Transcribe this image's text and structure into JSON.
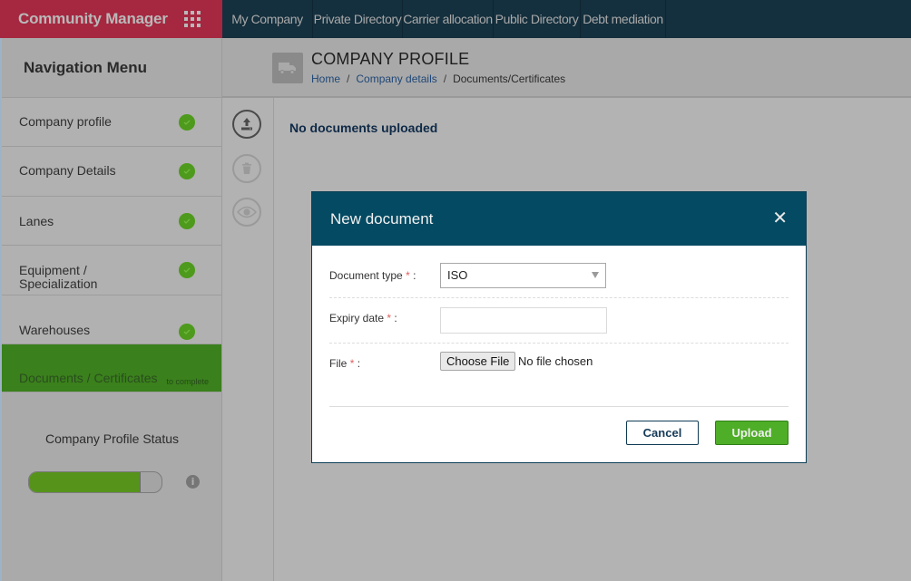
{
  "app": {
    "title": "Community Manager",
    "apps_icon": "grid-icon"
  },
  "topnav": {
    "items": [
      {
        "label": "My Company"
      },
      {
        "label": "Private Directory"
      },
      {
        "label": "Carrier allocation"
      },
      {
        "label": "Public Directory"
      },
      {
        "label": "Debt mediation"
      }
    ]
  },
  "sidebar": {
    "title": "Navigation Menu",
    "items": [
      {
        "label": "Company profile",
        "status": "complete",
        "icon": "check-icon"
      },
      {
        "label": "Company Details",
        "status": "complete",
        "icon": "check-icon"
      },
      {
        "label": "Lanes",
        "status": "complete",
        "icon": "check-icon"
      },
      {
        "label": "Equipment / Specialization",
        "status": "complete",
        "icon": "check-icon"
      },
      {
        "label": "Warehouses",
        "status": "complete",
        "icon": "check-icon"
      },
      {
        "label": "Documents / Certificates",
        "status": "to complete",
        "active": true
      }
    ],
    "todo_label": "to complete",
    "profile_status": {
      "title": "Company Profile Status",
      "progress_percent": 84,
      "info_icon": "info-icon"
    }
  },
  "page": {
    "icon": "truck-icon",
    "title": "COMPANY PROFILE",
    "breadcrumb": [
      {
        "label": "Home",
        "link": true
      },
      {
        "label": "Company details",
        "link": true
      },
      {
        "label": "Documents/Certificates",
        "link": false
      }
    ],
    "separator": "/"
  },
  "toolbar": {
    "items": [
      {
        "name": "upload-icon",
        "enabled": true
      },
      {
        "name": "trash-icon",
        "enabled": false
      },
      {
        "name": "eye-icon",
        "enabled": false
      }
    ]
  },
  "content": {
    "empty_message": "No documents uploaded"
  },
  "modal": {
    "title": "New document",
    "close_glyph": "✕",
    "fields": {
      "document_type": {
        "label": "Document type",
        "required_mark": "*",
        "suffix": ":",
        "value": "ISO"
      },
      "expiry_date": {
        "label": "Expiry date",
        "required_mark": "*",
        "suffix": ":",
        "value": "",
        "placeholder": ""
      },
      "file": {
        "label": "File",
        "required_mark": "*",
        "suffix": ":",
        "button": "Choose File",
        "status": "No file chosen"
      }
    },
    "buttons": {
      "cancel": "Cancel",
      "upload": "Upload"
    }
  },
  "colors": {
    "brand": "#a52840",
    "topnav": "#142f3d",
    "modal_header": "#044a62",
    "success": "#4fae27",
    "active_nav": "#3a801c"
  }
}
